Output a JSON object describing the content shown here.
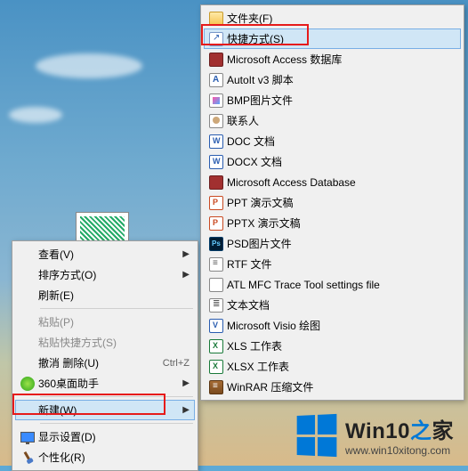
{
  "contextMenu": {
    "view": "查看(V)",
    "sort": "排序方式(O)",
    "refresh": "刷新(E)",
    "paste": "粘贴(P)",
    "pasteShortcut": "粘贴快捷方式(S)",
    "undoDelete": "撤消 删除(U)",
    "undoShortcut": "Ctrl+Z",
    "helper360": "360桌面助手",
    "new": "新建(W)",
    "displaySettings": "显示设置(D)",
    "personalize": "个性化(R)"
  },
  "newSubmenu": {
    "items": [
      {
        "label": "文件夹(F)",
        "icon": "folder"
      },
      {
        "label": "快捷方式(S)",
        "icon": "shortcut-ico",
        "highlight": true
      },
      {
        "label": "Microsoft Access 数据库",
        "icon": "access"
      },
      {
        "label": "AutoIt v3 脚本",
        "icon": "autoit"
      },
      {
        "label": "BMP图片文件",
        "icon": "bmp"
      },
      {
        "label": "联系人",
        "icon": "contact"
      },
      {
        "label": "DOC 文档",
        "icon": "doc"
      },
      {
        "label": "DOCX 文档",
        "icon": "doc"
      },
      {
        "label": "Microsoft Access Database",
        "icon": "access"
      },
      {
        "label": "PPT 演示文稿",
        "icon": "ppt"
      },
      {
        "label": "PPTX 演示文稿",
        "icon": "ppt"
      },
      {
        "label": "PSD图片文件",
        "icon": "psd"
      },
      {
        "label": "RTF 文件",
        "icon": "rtf"
      },
      {
        "label": "ATL MFC Trace Tool settings file",
        "icon": "generic"
      },
      {
        "label": "文本文档",
        "icon": "txt"
      },
      {
        "label": "Microsoft Visio 绘图",
        "icon": "visio"
      },
      {
        "label": "XLS 工作表",
        "icon": "xls"
      },
      {
        "label": "XLSX 工作表",
        "icon": "xls"
      },
      {
        "label": "WinRAR 压缩文件",
        "icon": "rar"
      }
    ]
  },
  "watermark": {
    "title_a": "Win10",
    "title_b": "之",
    "title_c": "家",
    "url": "www.win10xitong.com"
  }
}
